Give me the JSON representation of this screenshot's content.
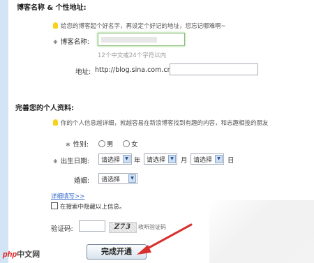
{
  "section1": {
    "title": "博客名称 & 个性地址:",
    "hint": "给您的博客起个好名字，再设定个好记的地址，您忘记哪难啊~",
    "blog_name_label": "博客名称:",
    "blog_name_value": "",
    "blog_name_note": "12个中文或24个字符以内",
    "address_label": "地址:",
    "address_prefix": "http://blog.sina.com.cn/",
    "address_value": ""
  },
  "section2": {
    "title": "完善您的个人资料:",
    "hint": "你的个人信息越详细，就越容易在新浪博客找到有趣的内容，和志趣相投的朋友",
    "gender_label": "性别:",
    "gender_male": "男",
    "gender_female": "女",
    "birthday_label": "出生日期:",
    "year_select": "请选择",
    "year_unit": "年",
    "month_select": "请选择",
    "month_unit": "月",
    "day_select": "请选择",
    "day_unit": "日",
    "marital_label": "婚姻:",
    "marital_select": "请选择",
    "details_link": "详细填写>>",
    "hide_info_label": "在搜索中隐藏以上信息。"
  },
  "captcha": {
    "label": "验证码:",
    "value": "",
    "image_text": "Z73",
    "refresh_link": "收听验证码"
  },
  "submit_label": "完成开通",
  "watermark": {
    "logo_php": "php",
    "logo_text": "中文网"
  },
  "colors": {
    "arrow": "#d9302e",
    "stripe": "#d3e4f6",
    "link": "#3366cc"
  }
}
